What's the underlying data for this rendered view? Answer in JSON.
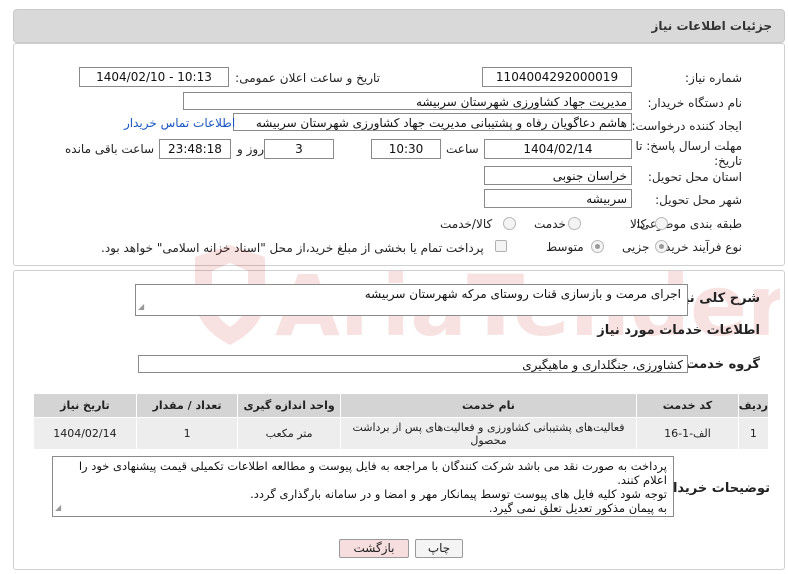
{
  "header": {
    "title": "جزئیات اطلاعات نیاز"
  },
  "form": {
    "need_number_label": "شماره نیاز:",
    "need_number": "1104004292000019",
    "announce_label": "تاریخ و ساعت اعلان عمومی:",
    "announce_value": "1404/02/10 - 10:13",
    "buyer_org_label": "نام دستگاه خریدار:",
    "buyer_org": "مدیریت جهاد کشاورزی شهرستان سربیشه",
    "creator_label": "ایجاد کننده درخواست:",
    "creator": "هاشم دعاگویان  رفاه و پشتیبانی مدیریت جهاد کشاورزی شهرستان سربیشه",
    "contact_link": "اطلاعات تماس خریدار",
    "deadline_label": "مهلت ارسال پاسخ: تا تاریخ:",
    "deadline_date": "1404/02/14",
    "time_label": "ساعت",
    "deadline_time": "10:30",
    "days_value": "3",
    "days_label": "روز و",
    "remaining_time": "23:48:18",
    "remaining_label": "ساعت باقی مانده",
    "province_label": "استان محل تحویل:",
    "province": "خراسان جنوبی",
    "city_label": "شهر محل تحویل:",
    "city": "سربیشه",
    "category_label": "طبقه بندی موضوعی:",
    "category_options": [
      "کالا",
      "خدمت",
      "کالا/خدمت"
    ],
    "category_selected": "خدمت",
    "process_label": "نوع فرآیند خرید :",
    "process_options": [
      "جزیی",
      "متوسط"
    ],
    "process_selected": "جزیی",
    "treasury_note": "پرداخت تمام یا بخشی از مبلغ خرید،از محل \"اسناد خزانه اسلامی\" خواهد بود."
  },
  "details": {
    "summary_label": "شرح کلی نیاز:",
    "summary": "اجرای مرمت و بازسازی قنات روستای مرکه شهرستان سربیشه",
    "services_heading": "اطلاعات خدمات مورد نیاز",
    "service_group_label": "گروه خدمت:",
    "service_group": "کشاورزی، جنگلداری و ماهیگیری",
    "table": {
      "headers": [
        "ردیف",
        "کد خدمت",
        "نام خدمت",
        "واحد اندازه گیری",
        "تعداد / مقدار",
        "تاریخ نیاز"
      ],
      "rows": [
        [
          "1",
          "الف-1-16",
          "فعالیت‌های پشتیبانی کشاورزی و فعالیت‌های پس از برداشت محصول",
          "متر مکعب",
          "1",
          "1404/02/14"
        ]
      ]
    },
    "buyer_notes_label": "توضیحات خریدار:",
    "buyer_notes": [
      "پرداخت به صورت نقد می باشد شرکت کنندگان با مراجعه به فایل پیوست و مطالعه اطلاعات تکمیلی قیمت پیشنهادی خود را اعلام کنند.",
      "توجه شود کلیه فایل های پیوست توسط پیمانکار مهر و امضا و در سامانه بارگذاری گردد.",
      "به پیمان مذکور تعدیل تعلق نمی گیرد."
    ]
  },
  "buttons": {
    "print": "چاپ",
    "back": "بازگشت"
  },
  "watermark": {
    "text": "AriaTender.neT"
  },
  "colors": {
    "link": "#1a56c4",
    "back_button_bg": "#f6dede",
    "watermark": "#cc2222"
  }
}
